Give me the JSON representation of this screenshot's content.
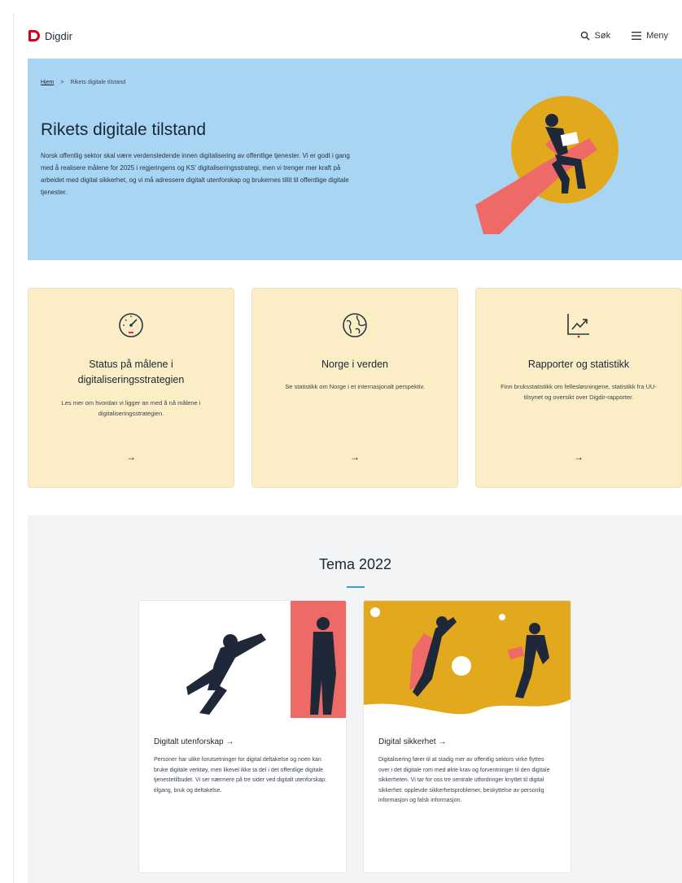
{
  "header": {
    "logo_text": "Digdir",
    "search_label": "Søk",
    "menu_label": "Meny"
  },
  "hero": {
    "breadcrumb_home": "Hjem",
    "breadcrumb_sep": ">",
    "breadcrumb_current": "Rikets digitale tilstand",
    "title": "Rikets digitale tilstand",
    "text": "Norsk offentlig sektor skal være verdensledende innen digitalisering av offentlige tjenester. Vi er godt i gang med å realisere målene for 2025 i regjeringens og KS' digitaliseringsstrategi, men vi trenger mer kraft på arbeidet med digital sikkerhet, og vi må adressere digitalt utenforskap og brukernes tillit til offentlige digitale tjenester."
  },
  "cards": [
    {
      "title": "Status på målene i digitaliseringsstrategien",
      "text": "Les mer om hvordan vi ligger an med å nå målene i digitaliseringsstrategien.",
      "arrow": "→",
      "icon": "gauge-icon"
    },
    {
      "title": "Norge i verden",
      "text": "Se statistikk om Norge i et internasjonalt perspektiv.",
      "arrow": "→",
      "icon": "globe-icon"
    },
    {
      "title": "Rapporter og statistikk",
      "text": "Finn bruksstatistikk om fellesløsningene, statistikk fra UU-tilsynet og oversikt over Digdir-rapporter.",
      "arrow": "→",
      "icon": "chart-trend-icon"
    }
  ],
  "tema": {
    "title": "Tema 2022",
    "items": [
      {
        "title": "Digitalt utenforskap →",
        "text": "Personer har ulike forutsetninger for digital deltakelse og noen kan bruke digitale verktøy, men likevel ikke ta del i det offentlige digitale tjenestetilbudet. Vi ser nærmere på tre sider ved digitalt utenforskap: tilgang, bruk og deltakelse."
      },
      {
        "title": "Digital sikkerhet →",
        "text": "Digitalisering fører til at stadig mer av offentlig sektors virke flyttes over i det digitale rom med økte krav og forventninger til den digitale sikkerheten. Vi tar for oss tre sentrale utfordringer knyttet til digital sikkerhet: opplevde sikkerhetsproblemer, beskyttelse av personlig informasjon og falsk informasjon."
      }
    ]
  },
  "colors": {
    "hero_bg": "#a9d5f5",
    "card_bg": "#fbeec6",
    "brand_red": "#d6001c",
    "accent_yellow": "#e2a91f",
    "accent_coral": "#ee6a66",
    "figure_navy": "#1f2838"
  }
}
